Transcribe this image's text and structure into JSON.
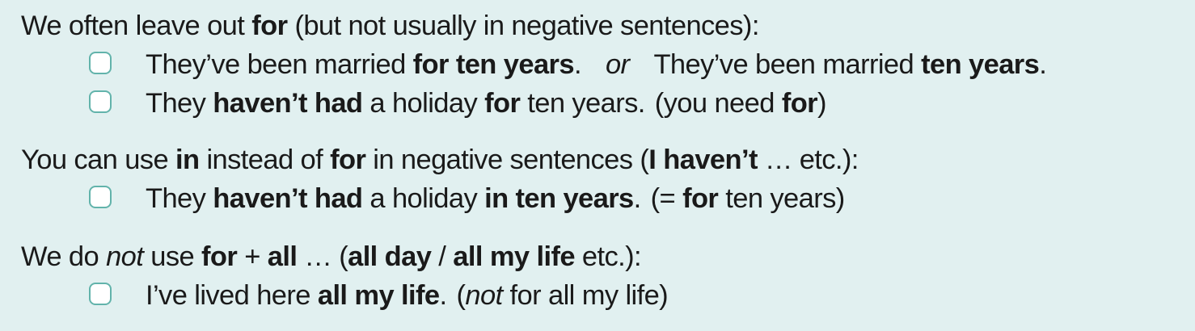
{
  "section1": {
    "heading": {
      "t1": "We often leave out ",
      "b1": "for",
      "t2": " (but not usually in negative sentences):"
    },
    "ex1": {
      "t1": "They’ve been married ",
      "b1": "for ten years",
      "t2": ".",
      "or": "or",
      "t3": "They’ve been married ",
      "b2": "ten years",
      "t4": "."
    },
    "ex2": {
      "t1": "They ",
      "b1": "haven’t had",
      "t2": " a holiday ",
      "b2": "for",
      "t3": " ten years.",
      "t4": "(you need ",
      "b3": "for",
      "t5": ")"
    }
  },
  "section2": {
    "heading": {
      "t1": "You can use ",
      "b1": "in",
      "t2": " instead of ",
      "b2": "for",
      "t3": " in negative sentences (",
      "b3": "I haven’t",
      "t4": " … etc.):"
    },
    "ex1": {
      "t1": "They ",
      "b1": "haven’t had",
      "t2": " a holiday ",
      "b2": "in ten years",
      "t3": ".",
      "t4": "(= ",
      "b3": "for",
      "t5": " ten years)"
    }
  },
  "section3": {
    "heading": {
      "t1": "We do ",
      "i1": "not",
      "t2": " use ",
      "b1": "for",
      "t3": " + ",
      "b2": "all",
      "t4": " … (",
      "b3": "all day",
      "t5": " / ",
      "b4": "all my life",
      "t6": " etc.):"
    },
    "ex1": {
      "t1": "I’ve lived here ",
      "b1": "all my life",
      "t2": ".",
      "t3": "(",
      "i1": "not",
      "t4": " for all my life)"
    }
  }
}
